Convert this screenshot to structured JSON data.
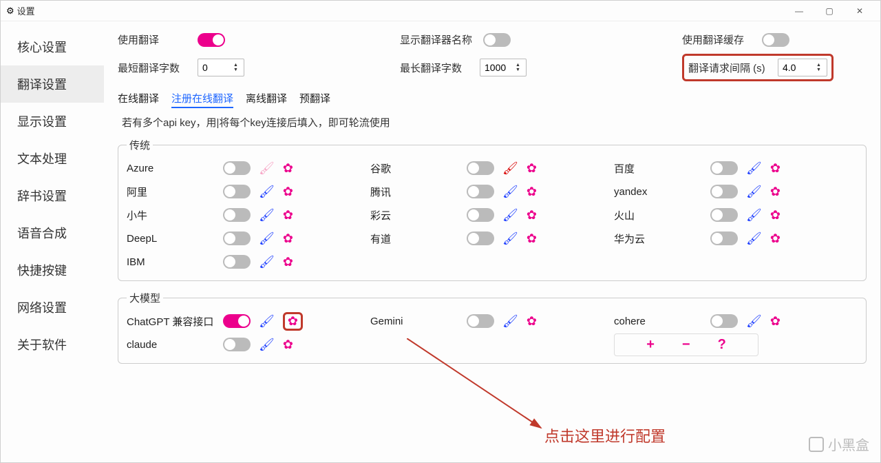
{
  "window": {
    "title": "设置"
  },
  "sidebar": {
    "items": [
      {
        "label": "核心设置"
      },
      {
        "label": "翻译设置"
      },
      {
        "label": "显示设置"
      },
      {
        "label": "文本处理"
      },
      {
        "label": "辞书设置"
      },
      {
        "label": "语音合成"
      },
      {
        "label": "快捷按键"
      },
      {
        "label": "网络设置"
      },
      {
        "label": "关于软件"
      }
    ],
    "active_index": 1
  },
  "top_settings": {
    "use_translate": "使用翻译",
    "min_chars": "最短翻译字数",
    "min_chars_value": "0",
    "show_name": "显示翻译器名称",
    "max_chars": "最长翻译字数",
    "max_chars_value": "1000",
    "use_cache": "使用翻译缓存",
    "interval": "翻译请求间隔 (s)",
    "interval_value": "4.0"
  },
  "tabs": {
    "items": [
      "在线翻译",
      "注册在线翻译",
      "离线翻译",
      "预翻译"
    ],
    "active_index": 1
  },
  "hint": "若有多个api key，用|将每个key连接后填入，即可轮流使用",
  "group_traditional": {
    "legend": "传统",
    "rows": [
      [
        {
          "name": "Azure",
          "brush": "pink"
        },
        {
          "name": "谷歌",
          "brush": "red"
        },
        {
          "name": "百度",
          "brush": "blue"
        }
      ],
      [
        {
          "name": "阿里",
          "brush": "blue"
        },
        {
          "name": "腾讯",
          "brush": "blue"
        },
        {
          "name": "yandex",
          "brush": "blue"
        }
      ],
      [
        {
          "name": "小牛",
          "brush": "blue"
        },
        {
          "name": "彩云",
          "brush": "blue"
        },
        {
          "name": "火山",
          "brush": "blue"
        }
      ],
      [
        {
          "name": "DeepL",
          "brush": "blue"
        },
        {
          "name": "有道",
          "brush": "blue"
        },
        {
          "name": "华为云",
          "brush": "blue"
        }
      ],
      [
        {
          "name": "IBM",
          "brush": "blue"
        },
        null,
        null
      ]
    ]
  },
  "group_llm": {
    "legend": "大模型",
    "rows": [
      [
        {
          "name": "ChatGPT 兼容接口",
          "brush": "blue",
          "on": true,
          "gear_hl": true
        },
        {
          "name": "Gemini",
          "brush": "blue"
        },
        {
          "name": "cohere",
          "brush": "blue"
        }
      ],
      [
        {
          "name": "claude",
          "brush": "blue"
        },
        null,
        {
          "actions": true
        }
      ]
    ]
  },
  "annotation": "点击这里进行配置",
  "watermark": "小黑盒"
}
